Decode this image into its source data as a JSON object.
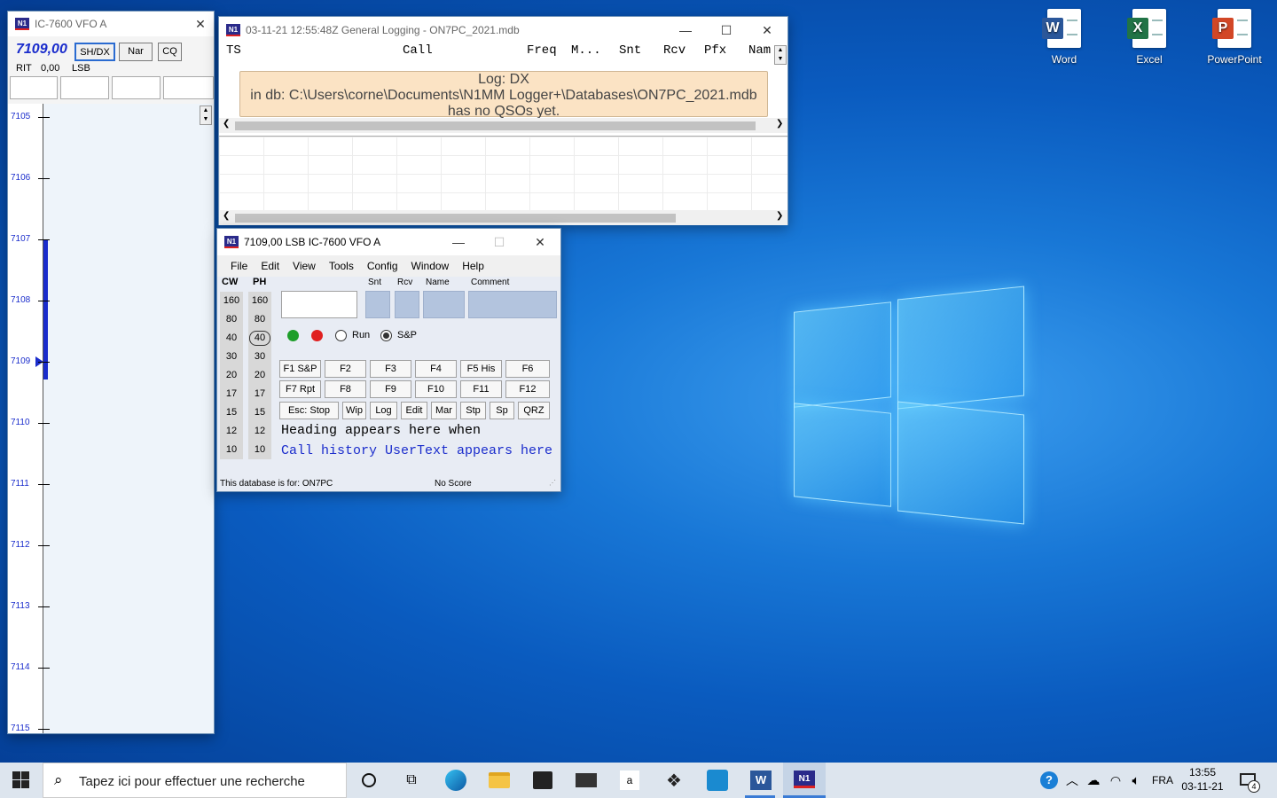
{
  "desktop": {
    "icons": [
      {
        "label": "Word",
        "letter": "W",
        "color": "#2b579a"
      },
      {
        "label": "Excel",
        "letter": "X",
        "color": "#217346"
      },
      {
        "label": "PowerPoint",
        "letter": "P",
        "color": "#d24726"
      }
    ]
  },
  "bandmap": {
    "title": "IC-7600 VFO A",
    "freq": "7109,00",
    "buttons": {
      "shdx": "SH/DX",
      "nar": "Nar",
      "cq": "CQ"
    },
    "rit_label": "RIT",
    "rit_value": "0,00",
    "mode": "LSB",
    "ticks": [
      "7105",
      "7106",
      "7107",
      "7108",
      "7109",
      "7110",
      "7111",
      "7112",
      "7113",
      "7114",
      "7115"
    ],
    "colors": {
      "freq_text": "#1a2ccc",
      "marker": "#1a2ccc"
    }
  },
  "log": {
    "title": "03-11-21 12:55:48Z  General Logging - ON7PC_2021.mdb",
    "columns": {
      "ts": "TS",
      "call": "Call",
      "freq": "Freq",
      "mode": "M...",
      "snt": "Snt",
      "rcv": "Rcv",
      "pfx": "Pfx",
      "name": "Nam"
    },
    "message": {
      "line1": "Log: DX",
      "line2": "in db: C:\\Users\\corne\\Documents\\N1MM Logger+\\Databases\\ON7PC_2021.mdb",
      "line3": "has no QSOs yet."
    }
  },
  "entry": {
    "title": "7109,00 LSB IC-7600 VFO A",
    "menu": {
      "file": "File",
      "edit": "Edit",
      "view": "View",
      "tools": "Tools",
      "config": "Config",
      "window": "Window",
      "help": "Help"
    },
    "field_labels": {
      "snt": "Snt",
      "rcv": "Rcv",
      "name": "Name",
      "comment": "Comment"
    },
    "band_headers": {
      "cw": "CW",
      "ph": "PH"
    },
    "bands": [
      "160",
      "80",
      "40",
      "30",
      "20",
      "17",
      "15",
      "12",
      "10"
    ],
    "selected_band": "40",
    "radio": {
      "run": "Run",
      "sp": "S&P",
      "selected": "S&P"
    },
    "fkeys_row1": [
      "F1 S&P",
      "F2",
      "F3",
      "F4",
      "F5 His",
      "F6"
    ],
    "fkeys_row2": [
      "F7 Rpt",
      "F8",
      "F9",
      "F10",
      "F11",
      "F12"
    ],
    "fkeys_row3": [
      "Esc: Stop",
      "Wip",
      "Log",
      "Edit",
      "Mar",
      "Stp",
      "Sp",
      "QRZ"
    ],
    "heading_text": "Heading appears here when",
    "history_text": "Call history UserText appears here",
    "status_left": "This database is for: ON7PC",
    "status_right": "No Score"
  },
  "taskbar": {
    "search_placeholder": "Tapez ici pour effectuer une recherche",
    "lang": "FRA",
    "time": "13:55",
    "date": "03-11-21",
    "notifications": "4"
  }
}
